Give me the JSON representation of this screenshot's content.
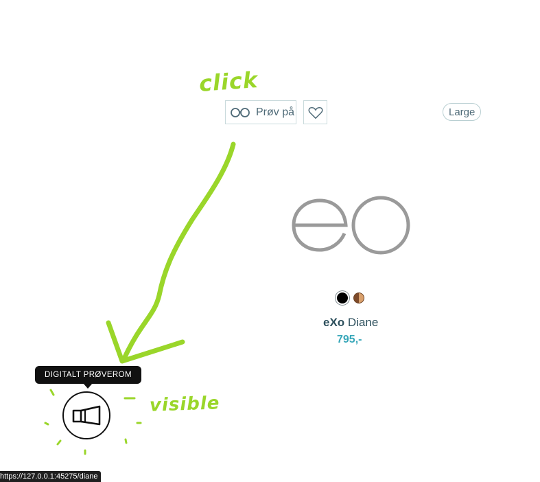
{
  "annotations": {
    "click_note": "click",
    "visible_note": "visible"
  },
  "product": {
    "try_on_label": "Prøv på",
    "size_label": "Large",
    "brand": "eXo",
    "model": "Diane",
    "price": "795,-",
    "swatches": [
      "black",
      "wood"
    ]
  },
  "fitting_room": {
    "tooltip": "DIGITALT PRØVEROM"
  },
  "status_bar": {
    "url": "https://127.0.0.1:45275/diane"
  },
  "colors": {
    "annotation_green": "#9ad62a",
    "accent_teal": "#38a7b9",
    "text_dark_teal": "#2c4f5c"
  },
  "icons": [
    "glasses-icon",
    "heart-icon",
    "fitting-room-icon"
  ]
}
